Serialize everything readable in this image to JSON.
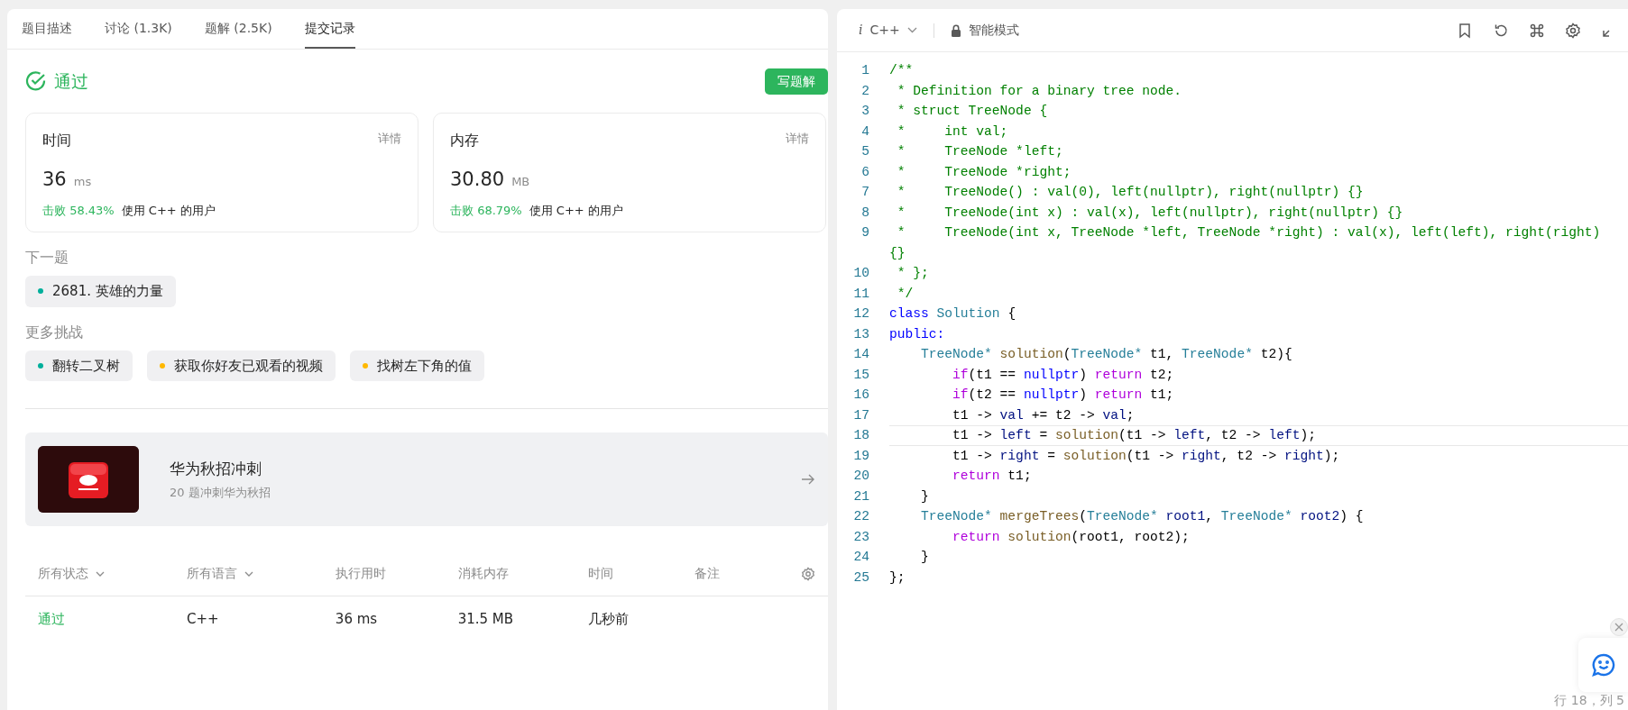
{
  "left_panel": {
    "tabs": [
      {
        "label": "题目描述",
        "selected": false
      },
      {
        "label": "讨论 (1.3K)",
        "selected": false
      },
      {
        "label": "题解 (2.5K)",
        "selected": false
      },
      {
        "label": "提交记录",
        "selected": true
      }
    ],
    "result": {
      "status": "通过",
      "write_button": "写题解"
    },
    "metrics": [
      {
        "title": "时间",
        "detail": "详情",
        "value": "36",
        "unit": "ms",
        "beat": "击败 58.43%",
        "beat_desc": "使用 C++ 的用户"
      },
      {
        "title": "内存",
        "detail": "详情",
        "value": "30.80",
        "unit": "MB",
        "beat": "击败 68.79%",
        "beat_desc": "使用 C++ 的用户"
      }
    ],
    "next_label": "下一题",
    "next_problems": [
      {
        "text": "2681. 英雄的力量",
        "color": "#00af9b"
      }
    ],
    "more_label": "更多挑战",
    "more_problems": [
      {
        "text": "翻转二叉树",
        "color": "#00af9b"
      },
      {
        "text": "获取你好友已观看的视频",
        "color": "#ffb800"
      },
      {
        "text": "找树左下角的值",
        "color": "#ffb800"
      }
    ],
    "promo": {
      "kind": "picture",
      "title": "华为秋招冲刺",
      "subtitle": "20 题冲刺华为秋招"
    },
    "table": {
      "columns": [
        {
          "label": "所有状态",
          "dropdown": true
        },
        {
          "label": "所有语言",
          "dropdown": true
        },
        {
          "label": "执行用时",
          "dropdown": false
        },
        {
          "label": "消耗内存",
          "dropdown": false
        },
        {
          "label": "时间",
          "dropdown": false
        },
        {
          "label": "备注",
          "dropdown": false
        }
      ],
      "rows": [
        {
          "status": "通过",
          "language": "C++",
          "runtime": "36 ms",
          "memory": "31.5 MB",
          "time": "几秒前"
        }
      ]
    }
  },
  "editor": {
    "language_icon": "i",
    "language": "C++",
    "mode": "智能模式",
    "lines": [
      {
        "number": "1",
        "current": false,
        "tokens": [
          {
            "text": "/**",
            "kind": "comment"
          }
        ]
      },
      {
        "number": "2",
        "current": false,
        "tokens": [
          {
            "text": " * Definition for a binary tree node.",
            "kind": "comment"
          }
        ]
      },
      {
        "number": "3",
        "current": false,
        "tokens": [
          {
            "text": " * struct TreeNode {",
            "kind": "comment"
          }
        ]
      },
      {
        "number": "4",
        "current": false,
        "tokens": [
          {
            "text": " *     int val;",
            "kind": "comment"
          }
        ]
      },
      {
        "number": "5",
        "current": false,
        "tokens": [
          {
            "text": " *     TreeNode *left;",
            "kind": "comment"
          }
        ]
      },
      {
        "number": "6",
        "current": false,
        "tokens": [
          {
            "text": " *     TreeNode *right;",
            "kind": "comment"
          }
        ]
      },
      {
        "number": "7",
        "current": false,
        "tokens": [
          {
            "text": " *     TreeNode() : val(0), left(nullptr), right(nullptr) {}",
            "kind": "comment"
          }
        ]
      },
      {
        "number": "8",
        "current": false,
        "tokens": [
          {
            "text": " *     TreeNode(int x) : val(x), left(nullptr), right(nullptr) {}",
            "kind": "comment"
          }
        ]
      },
      {
        "number": "9",
        "current": false,
        "tokens": [
          {
            "text": " *     TreeNode(int x, TreeNode *left, TreeNode *right) : val(x), left(left), right(right)",
            "kind": "comment"
          }
        ]
      },
      {
        "current": false,
        "tokens": [
          {
            "text": "{}",
            "kind": "comment"
          }
        ]
      },
      {
        "number": "10",
        "current": false,
        "tokens": [
          {
            "text": " * };",
            "kind": "comment"
          }
        ]
      },
      {
        "number": "11",
        "current": false,
        "tokens": [
          {
            "text": " */",
            "kind": "comment"
          }
        ]
      },
      {
        "number": "12",
        "current": false,
        "tokens": [
          {
            "text": "class",
            "kind": "keyword"
          },
          {
            "text": " Solution",
            "kind": "type"
          },
          {
            "text": " {",
            "kind": "plain"
          }
        ]
      },
      {
        "number": "13",
        "current": false,
        "tokens": [
          {
            "text": "public:",
            "kind": "keyword"
          }
        ]
      },
      {
        "number": "14",
        "current": false,
        "tokens": [
          {
            "text": "    TreeNode*",
            "kind": "type"
          },
          {
            "text": " solution",
            "kind": "function"
          },
          {
            "text": "(",
            "kind": "plain"
          },
          {
            "text": "TreeNode*",
            "kind": "type"
          },
          {
            "text": " t1, ",
            "kind": "plain"
          },
          {
            "text": "TreeNode*",
            "kind": "type"
          },
          {
            "text": " t2){",
            "kind": "plain"
          }
        ]
      },
      {
        "number": "15",
        "current": false,
        "tokens": [
          {
            "text": "        if",
            "kind": "control"
          },
          {
            "text": "(t1 == ",
            "kind": "plain"
          },
          {
            "text": "nullptr",
            "kind": "keyword"
          },
          {
            "text": ") ",
            "kind": "plain"
          },
          {
            "text": "return",
            "kind": "control"
          },
          {
            "text": " t2;",
            "kind": "plain"
          }
        ]
      },
      {
        "number": "16",
        "current": false,
        "tokens": [
          {
            "text": "        if",
            "kind": "control"
          },
          {
            "text": "(t2 == ",
            "kind": "plain"
          },
          {
            "text": "nullptr",
            "kind": "keyword"
          },
          {
            "text": ") ",
            "kind": "plain"
          },
          {
            "text": "return",
            "kind": "control"
          },
          {
            "text": " t1;",
            "kind": "plain"
          }
        ]
      },
      {
        "number": "17",
        "current": false,
        "tokens": [
          {
            "text": "        t1 -> ",
            "kind": "plain"
          },
          {
            "text": "val",
            "kind": "member"
          },
          {
            "text": " += t2 -> ",
            "kind": "plain"
          },
          {
            "text": "val",
            "kind": "member"
          },
          {
            "text": ";",
            "kind": "plain"
          }
        ]
      },
      {
        "number": "18",
        "current": true,
        "tokens": [
          {
            "text": "        t1 -> ",
            "kind": "plain"
          },
          {
            "text": "left",
            "kind": "member"
          },
          {
            "text": " = ",
            "kind": "plain"
          },
          {
            "text": "solution",
            "kind": "function"
          },
          {
            "text": "(t1 -> ",
            "kind": "plain"
          },
          {
            "text": "left",
            "kind": "member"
          },
          {
            "text": ", t2 -> ",
            "kind": "plain"
          },
          {
            "text": "left",
            "kind": "member"
          },
          {
            "text": ");",
            "kind": "plain"
          }
        ]
      },
      {
        "number": "19",
        "current": false,
        "tokens": [
          {
            "text": "        t1 -> ",
            "kind": "plain"
          },
          {
            "text": "right",
            "kind": "member"
          },
          {
            "text": " = ",
            "kind": "plain"
          },
          {
            "text": "solution",
            "kind": "function"
          },
          {
            "text": "(t1 -> ",
            "kind": "plain"
          },
          {
            "text": "right",
            "kind": "member"
          },
          {
            "text": ", t2 -> ",
            "kind": "plain"
          },
          {
            "text": "right",
            "kind": "member"
          },
          {
            "text": ");",
            "kind": "plain"
          }
        ]
      },
      {
        "number": "20",
        "current": false,
        "tokens": [
          {
            "text": "        return",
            "kind": "control"
          },
          {
            "text": " t1;",
            "kind": "plain"
          }
        ]
      },
      {
        "number": "21",
        "current": false,
        "tokens": [
          {
            "text": "    }",
            "kind": "plain"
          }
        ]
      },
      {
        "number": "22",
        "current": false,
        "tokens": [
          {
            "text": "    TreeNode*",
            "kind": "type"
          },
          {
            "text": " mergeTrees",
            "kind": "function"
          },
          {
            "text": "(",
            "kind": "plain"
          },
          {
            "text": "TreeNode*",
            "kind": "type"
          },
          {
            "text": " root1",
            "kind": "member"
          },
          {
            "text": ", ",
            "kind": "plain"
          },
          {
            "text": "TreeNode*",
            "kind": "type"
          },
          {
            "text": " root2",
            "kind": "member"
          },
          {
            "text": ") {",
            "kind": "plain"
          }
        ]
      },
      {
        "number": "23",
        "current": false,
        "tokens": [
          {
            "text": "        return",
            "kind": "control"
          },
          {
            "text": " solution",
            "kind": "function"
          },
          {
            "text": "(root1, root2);",
            "kind": "plain"
          }
        ]
      },
      {
        "number": "24",
        "current": false,
        "tokens": [
          {
            "text": "    }",
            "kind": "plain"
          }
        ]
      },
      {
        "number": "25",
        "current": false,
        "tokens": [
          {
            "text": "};",
            "kind": "plain"
          }
        ]
      }
    ],
    "status_bar": "行 18，列 5"
  }
}
